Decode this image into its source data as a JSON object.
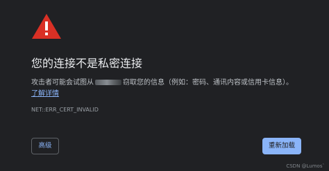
{
  "icons": {
    "warning": "warning-triangle-icon",
    "warning_color": "#d93025"
  },
  "page": {
    "title": "您的连接不是私密连接",
    "message_start": "攻击者可能会试图从",
    "message_end": "窃取您的信息（例如：密码、通讯内容或信用卡信息）。",
    "learn_more": "了解详情",
    "error_code": "NET::ERR_CERT_INVALID"
  },
  "buttons": {
    "advanced": "高级",
    "reload": "重新加载"
  },
  "watermark": "CSDN @Lumos`"
}
